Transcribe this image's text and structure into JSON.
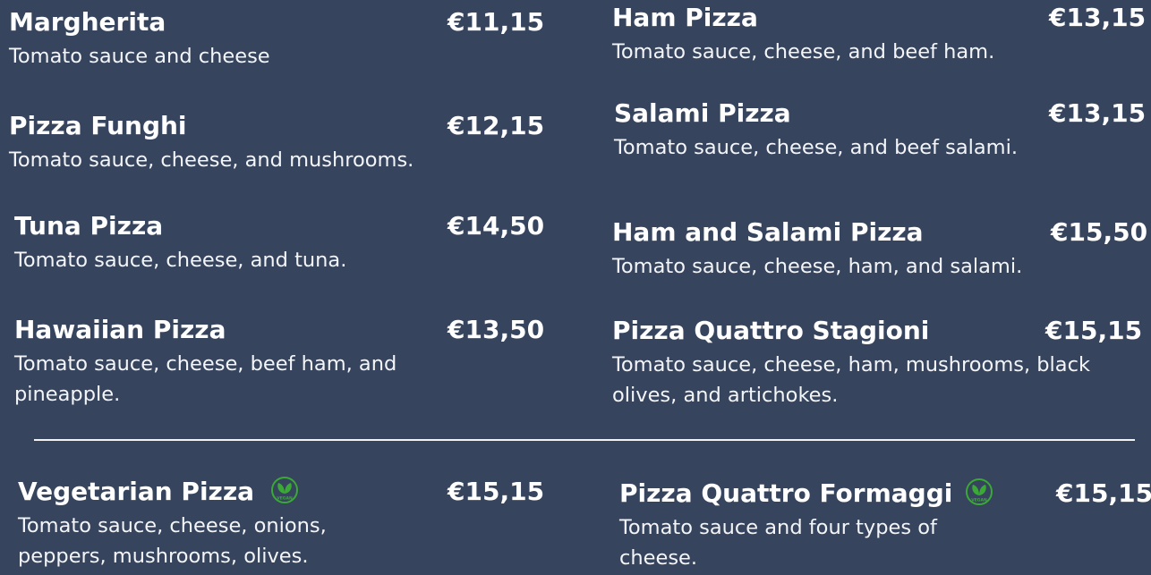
{
  "left_column": [
    {
      "name": "Margherita",
      "price": "€11,15",
      "description": "Tomato sauce and cheese"
    },
    {
      "name": "Pizza Funghi",
      "price": "€12,15",
      "description": "Tomato sauce, cheese, and mushrooms."
    },
    {
      "name": "Tuna Pizza",
      "price": "€14,50",
      "description": "Tomato sauce, cheese, and tuna."
    },
    {
      "name": "Hawaiian Pizza",
      "price": "€13,50",
      "description": "Tomato sauce, cheese, beef ham, and pineapple."
    }
  ],
  "right_column": [
    {
      "name": "Ham Pizza",
      "price": "€13,15",
      "description": "Tomato sauce, cheese, and beef ham."
    },
    {
      "name": "Salami Pizza",
      "price": "€13,15",
      "description": "Tomato sauce, cheese, and beef salami."
    },
    {
      "name": "Ham and Salami Pizza",
      "price": "€15,50",
      "description": "Tomato sauce, cheese, ham, and salami."
    },
    {
      "name": "Pizza Quattro Stagioni",
      "price": "€15,15",
      "description": "Tomato sauce, cheese, ham, mushrooms, black olives, and artichokes."
    }
  ],
  "vegan_items": [
    {
      "name": "Vegetarian Pizza",
      "price": "€15,15",
      "description": "Tomato sauce, cheese, onions, peppers, mushrooms, olives.",
      "badge": "VEGAN"
    },
    {
      "name": "Pizza Quattro Formaggi",
      "price": "€15,15",
      "description": "Tomato sauce and four types of cheese.",
      "badge": "VEGAN"
    }
  ],
  "colors": {
    "background": "#36445e",
    "text": "#ffffff",
    "vegan_badge": "#3aa935"
  },
  "icons": {
    "vegan_badge": "vegan-leaf-icon"
  }
}
